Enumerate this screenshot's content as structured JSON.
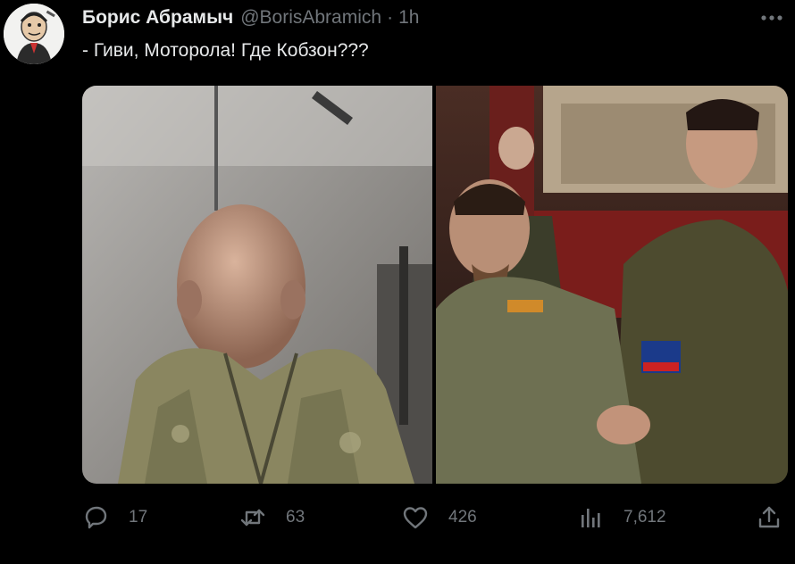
{
  "author": {
    "display_name": "Борис Абрамыч",
    "handle": "@BorisAbramich",
    "time": "1h",
    "avatar_icon": "caricature-avatar"
  },
  "tweet": {
    "text": "- Гиви, Моторола! Где Кобзон???"
  },
  "media": {
    "photo_count": 2,
    "left_photo_icon": "photo",
    "right_photo_icon": "photo"
  },
  "actions": {
    "reply_count": "17",
    "retweet_count": "63",
    "like_count": "426",
    "views_count": "7,612"
  },
  "colors": {
    "background": "#000000",
    "text_primary": "#e7e9ea",
    "text_secondary": "#71767b"
  }
}
